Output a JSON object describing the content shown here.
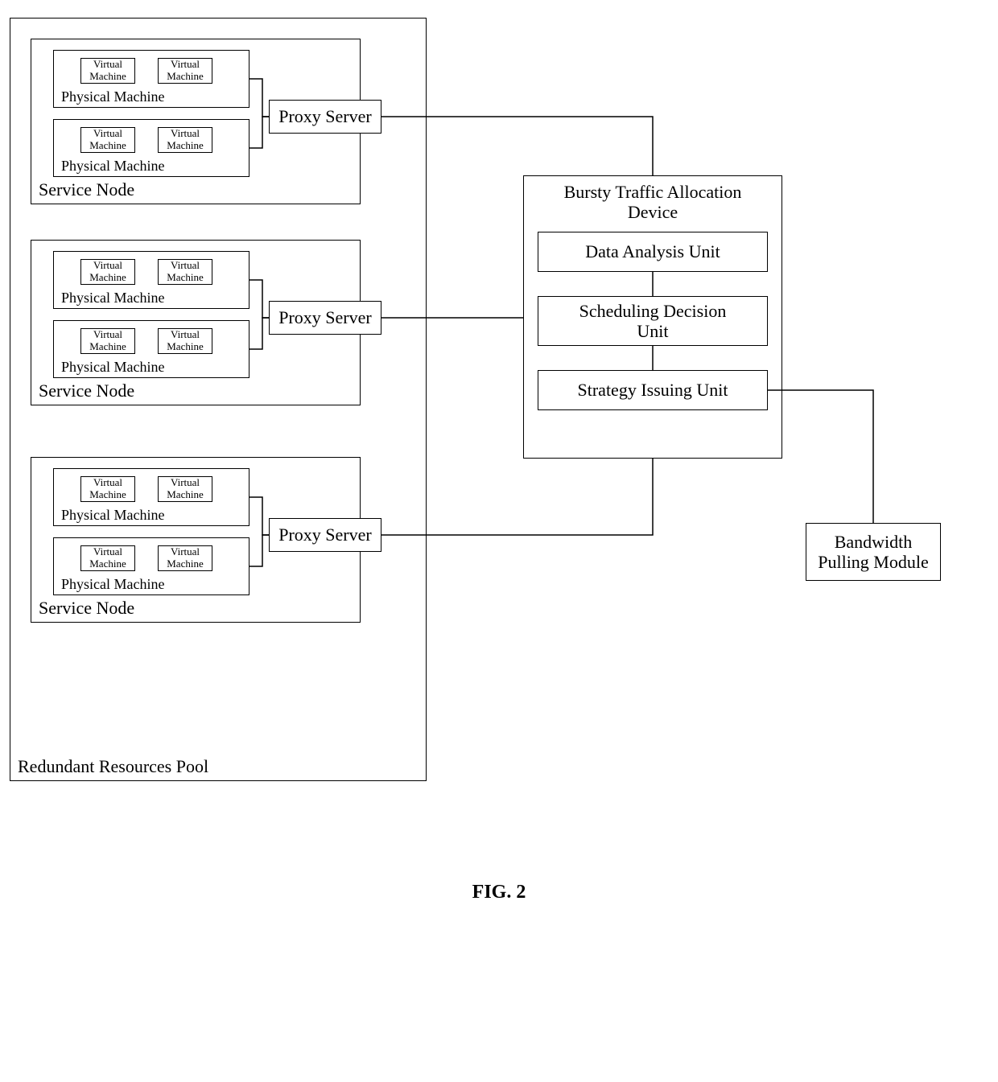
{
  "labels": {
    "vm": "Virtual\nMachine",
    "pm": "Physical Machine",
    "sn": "Service Node",
    "ps": "Proxy Server",
    "pool": "Redundant Resources Pool",
    "device_title": "Bursty Traffic Allocation\nDevice",
    "unit_data": "Data Analysis Unit",
    "unit_sched": "Scheduling Decision\nUnit",
    "unit_strat": "Strategy Issuing Unit",
    "bwm": "Bandwidth\nPulling Module",
    "figure": "FIG. 2"
  }
}
